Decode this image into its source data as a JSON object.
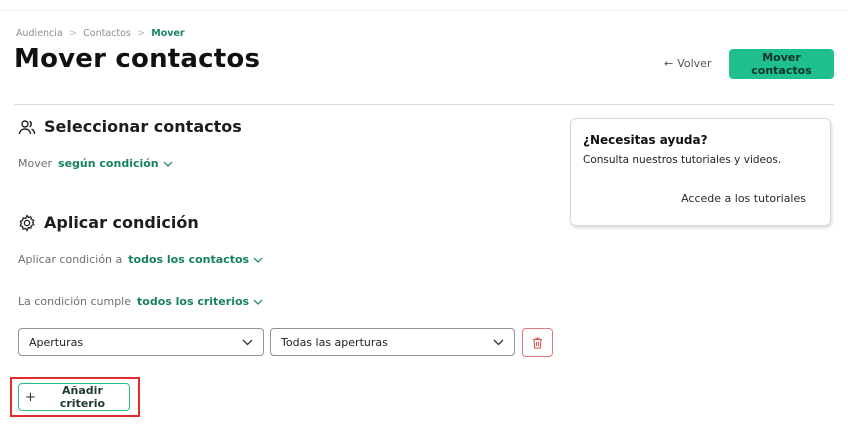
{
  "breadcrumb": {
    "items": [
      "Audiencia",
      "Contactos"
    ],
    "current": "Mover",
    "separator": ">"
  },
  "page": {
    "title": "Mover contactos"
  },
  "header_actions": {
    "back_label": "Volver",
    "back_arrow": "←",
    "primary_label": "Mover contactos",
    "primary_color": "#20c08e"
  },
  "select_section": {
    "title": "Seleccionar contactos",
    "icon": "users-icon",
    "move_label": "Mover",
    "move_value": "según condición"
  },
  "condition_section": {
    "title": "Aplicar condición",
    "icon": "gear-icon",
    "apply_label": "Aplicar condición a",
    "apply_value": "todos los contactos",
    "match_label": "La condición cumple",
    "match_value": "todos los criterios"
  },
  "criteria": [
    {
      "field": "Aperturas",
      "operator": "Todas las aperturas"
    }
  ],
  "add_criterion": {
    "plus": "+",
    "label": "Añadir criterio",
    "highlight_color": "#e12d2d"
  },
  "help": {
    "title": "¿Necesitas ayuda?",
    "text": "Consulta nuestros tutoriales y videos.",
    "link": "Accede a los tutoriales"
  },
  "colors": {
    "accent": "#20c08e",
    "accent_text": "#17825f",
    "danger": "#e0797d"
  }
}
